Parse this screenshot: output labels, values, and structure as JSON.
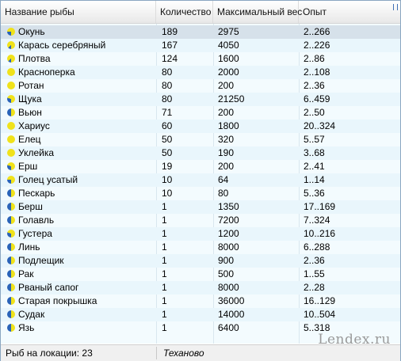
{
  "columns": [
    "Название рыбы",
    "Количество",
    "Максимальный вес",
    "Опыт"
  ],
  "rows": [
    {
      "name": "Окунь",
      "count": "189",
      "max_weight": "2975",
      "exp": "2..266",
      "icon": {
        "fill": 0.25,
        "color": "#f0e21a"
      }
    },
    {
      "name": "Карась серебряный",
      "count": "167",
      "max_weight": "4050",
      "exp": "2..226",
      "icon": {
        "fill": 0.125,
        "color": "#f0e21a"
      }
    },
    {
      "name": "Плотва",
      "count": "124",
      "max_weight": "1600",
      "exp": "2..86",
      "icon": {
        "fill": 0.125,
        "color": "#f0e21a"
      }
    },
    {
      "name": "Красноперка",
      "count": "80",
      "max_weight": "2000",
      "exp": "2..108",
      "icon": {
        "fill": 0,
        "color": "#f0e21a"
      }
    },
    {
      "name": "Ротан",
      "count": "80",
      "max_weight": "200",
      "exp": "2..36",
      "icon": {
        "fill": 0,
        "color": "#f0e21a"
      }
    },
    {
      "name": "Щука",
      "count": "80",
      "max_weight": "21250",
      "exp": "6..459",
      "icon": {
        "fill": 0.3,
        "color": "#f0e21a"
      }
    },
    {
      "name": "Вьюн",
      "count": "71",
      "max_weight": "200",
      "exp": "2..50",
      "icon": {
        "fill": 0.5,
        "color": "#f0e21a"
      }
    },
    {
      "name": "Хариус",
      "count": "60",
      "max_weight": "1800",
      "exp": "20..324",
      "icon": {
        "fill": 0,
        "color": "#f0e21a"
      }
    },
    {
      "name": "Елец",
      "count": "50",
      "max_weight": "320",
      "exp": "5..57",
      "icon": {
        "fill": 0,
        "color": "#f0e21a"
      }
    },
    {
      "name": "Уклейка",
      "count": "50",
      "max_weight": "190",
      "exp": "3..68",
      "icon": {
        "fill": 0,
        "color": "#f0e21a"
      }
    },
    {
      "name": "Ерш",
      "count": "19",
      "max_weight": "200",
      "exp": "2..41",
      "icon": {
        "fill": 0.3,
        "color": "#f0e21a"
      }
    },
    {
      "name": "Голец усатый",
      "count": "10",
      "max_weight": "64",
      "exp": "1..14",
      "icon": {
        "fill": 0.25,
        "color": "#f0e21a"
      }
    },
    {
      "name": "Пескарь",
      "count": "10",
      "max_weight": "80",
      "exp": "5..36",
      "icon": {
        "fill": 0.5,
        "color": "#f0e21a"
      }
    },
    {
      "name": "Берш",
      "count": "1",
      "max_weight": "1350",
      "exp": "17..169",
      "icon": {
        "fill": 0.5,
        "color": "#f0e21a"
      }
    },
    {
      "name": "Голавль",
      "count": "1",
      "max_weight": "7200",
      "exp": "7..324",
      "icon": {
        "fill": 0.5,
        "color": "#f0e21a"
      }
    },
    {
      "name": "Густера",
      "count": "1",
      "max_weight": "1200",
      "exp": "10..216",
      "icon": {
        "fill": 0.3,
        "color": "#f0e21a"
      }
    },
    {
      "name": "Линь",
      "count": "1",
      "max_weight": "8000",
      "exp": "6..288",
      "icon": {
        "fill": 0.5,
        "color": "#f0e21a"
      }
    },
    {
      "name": "Подлещик",
      "count": "1",
      "max_weight": "900",
      "exp": "2..36",
      "icon": {
        "fill": 0.5,
        "color": "#f0e21a"
      }
    },
    {
      "name": "Рак",
      "count": "1",
      "max_weight": "500",
      "exp": "1..55",
      "icon": {
        "fill": 0.5,
        "color": "#f0e21a"
      }
    },
    {
      "name": "Рваный сапог",
      "count": "1",
      "max_weight": "8000",
      "exp": "2..28",
      "icon": {
        "fill": 0.5,
        "color": "#f0e21a"
      }
    },
    {
      "name": "Старая покрышка",
      "count": "1",
      "max_weight": "36000",
      "exp": "16..129",
      "icon": {
        "fill": 0.5,
        "color": "#f0e21a"
      }
    },
    {
      "name": "Судак",
      "count": "1",
      "max_weight": "14000",
      "exp": "10..504",
      "icon": {
        "fill": 0.5,
        "color": "#f0e21a"
      }
    },
    {
      "name": "Язь",
      "count": "1",
      "max_weight": "6400",
      "exp": "5..318",
      "icon": {
        "fill": 0.5,
        "color": "#f0e21a"
      }
    }
  ],
  "status": {
    "fish_count_label": "Рыб на локации: 23",
    "location": "Теханово"
  },
  "watermark": "Lendex.ru",
  "colors": {
    "pie_yellow": "#f0e21a",
    "pie_blue": "#2a63b8",
    "selected_row": "#d6e1ea",
    "row_even": "#e9f6fc",
    "row_odd": "#f3fbfe"
  }
}
